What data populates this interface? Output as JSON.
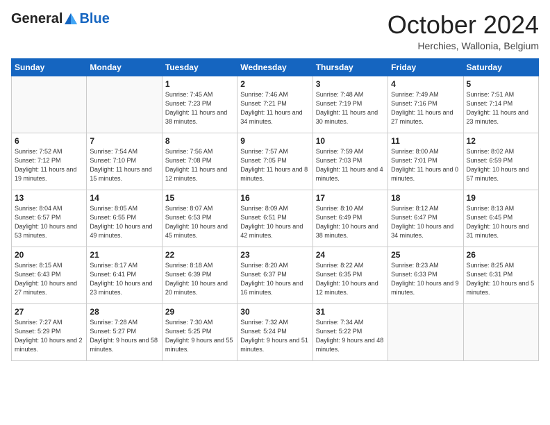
{
  "logo": {
    "general": "General",
    "blue": "Blue"
  },
  "header": {
    "month": "October 2024",
    "location": "Herchies, Wallonia, Belgium"
  },
  "days_of_week": [
    "Sunday",
    "Monday",
    "Tuesday",
    "Wednesday",
    "Thursday",
    "Friday",
    "Saturday"
  ],
  "weeks": [
    [
      {
        "day": "",
        "sunrise": "",
        "sunset": "",
        "daylight": ""
      },
      {
        "day": "",
        "sunrise": "",
        "sunset": "",
        "daylight": ""
      },
      {
        "day": "1",
        "sunrise": "Sunrise: 7:45 AM",
        "sunset": "Sunset: 7:23 PM",
        "daylight": "Daylight: 11 hours and 38 minutes."
      },
      {
        "day": "2",
        "sunrise": "Sunrise: 7:46 AM",
        "sunset": "Sunset: 7:21 PM",
        "daylight": "Daylight: 11 hours and 34 minutes."
      },
      {
        "day": "3",
        "sunrise": "Sunrise: 7:48 AM",
        "sunset": "Sunset: 7:19 PM",
        "daylight": "Daylight: 11 hours and 30 minutes."
      },
      {
        "day": "4",
        "sunrise": "Sunrise: 7:49 AM",
        "sunset": "Sunset: 7:16 PM",
        "daylight": "Daylight: 11 hours and 27 minutes."
      },
      {
        "day": "5",
        "sunrise": "Sunrise: 7:51 AM",
        "sunset": "Sunset: 7:14 PM",
        "daylight": "Daylight: 11 hours and 23 minutes."
      }
    ],
    [
      {
        "day": "6",
        "sunrise": "Sunrise: 7:52 AM",
        "sunset": "Sunset: 7:12 PM",
        "daylight": "Daylight: 11 hours and 19 minutes."
      },
      {
        "day": "7",
        "sunrise": "Sunrise: 7:54 AM",
        "sunset": "Sunset: 7:10 PM",
        "daylight": "Daylight: 11 hours and 15 minutes."
      },
      {
        "day": "8",
        "sunrise": "Sunrise: 7:56 AM",
        "sunset": "Sunset: 7:08 PM",
        "daylight": "Daylight: 11 hours and 12 minutes."
      },
      {
        "day": "9",
        "sunrise": "Sunrise: 7:57 AM",
        "sunset": "Sunset: 7:05 PM",
        "daylight": "Daylight: 11 hours and 8 minutes."
      },
      {
        "day": "10",
        "sunrise": "Sunrise: 7:59 AM",
        "sunset": "Sunset: 7:03 PM",
        "daylight": "Daylight: 11 hours and 4 minutes."
      },
      {
        "day": "11",
        "sunrise": "Sunrise: 8:00 AM",
        "sunset": "Sunset: 7:01 PM",
        "daylight": "Daylight: 11 hours and 0 minutes."
      },
      {
        "day": "12",
        "sunrise": "Sunrise: 8:02 AM",
        "sunset": "Sunset: 6:59 PM",
        "daylight": "Daylight: 10 hours and 57 minutes."
      }
    ],
    [
      {
        "day": "13",
        "sunrise": "Sunrise: 8:04 AM",
        "sunset": "Sunset: 6:57 PM",
        "daylight": "Daylight: 10 hours and 53 minutes."
      },
      {
        "day": "14",
        "sunrise": "Sunrise: 8:05 AM",
        "sunset": "Sunset: 6:55 PM",
        "daylight": "Daylight: 10 hours and 49 minutes."
      },
      {
        "day": "15",
        "sunrise": "Sunrise: 8:07 AM",
        "sunset": "Sunset: 6:53 PM",
        "daylight": "Daylight: 10 hours and 45 minutes."
      },
      {
        "day": "16",
        "sunrise": "Sunrise: 8:09 AM",
        "sunset": "Sunset: 6:51 PM",
        "daylight": "Daylight: 10 hours and 42 minutes."
      },
      {
        "day": "17",
        "sunrise": "Sunrise: 8:10 AM",
        "sunset": "Sunset: 6:49 PM",
        "daylight": "Daylight: 10 hours and 38 minutes."
      },
      {
        "day": "18",
        "sunrise": "Sunrise: 8:12 AM",
        "sunset": "Sunset: 6:47 PM",
        "daylight": "Daylight: 10 hours and 34 minutes."
      },
      {
        "day": "19",
        "sunrise": "Sunrise: 8:13 AM",
        "sunset": "Sunset: 6:45 PM",
        "daylight": "Daylight: 10 hours and 31 minutes."
      }
    ],
    [
      {
        "day": "20",
        "sunrise": "Sunrise: 8:15 AM",
        "sunset": "Sunset: 6:43 PM",
        "daylight": "Daylight: 10 hours and 27 minutes."
      },
      {
        "day": "21",
        "sunrise": "Sunrise: 8:17 AM",
        "sunset": "Sunset: 6:41 PM",
        "daylight": "Daylight: 10 hours and 23 minutes."
      },
      {
        "day": "22",
        "sunrise": "Sunrise: 8:18 AM",
        "sunset": "Sunset: 6:39 PM",
        "daylight": "Daylight: 10 hours and 20 minutes."
      },
      {
        "day": "23",
        "sunrise": "Sunrise: 8:20 AM",
        "sunset": "Sunset: 6:37 PM",
        "daylight": "Daylight: 10 hours and 16 minutes."
      },
      {
        "day": "24",
        "sunrise": "Sunrise: 8:22 AM",
        "sunset": "Sunset: 6:35 PM",
        "daylight": "Daylight: 10 hours and 12 minutes."
      },
      {
        "day": "25",
        "sunrise": "Sunrise: 8:23 AM",
        "sunset": "Sunset: 6:33 PM",
        "daylight": "Daylight: 10 hours and 9 minutes."
      },
      {
        "day": "26",
        "sunrise": "Sunrise: 8:25 AM",
        "sunset": "Sunset: 6:31 PM",
        "daylight": "Daylight: 10 hours and 5 minutes."
      }
    ],
    [
      {
        "day": "27",
        "sunrise": "Sunrise: 7:27 AM",
        "sunset": "Sunset: 5:29 PM",
        "daylight": "Daylight: 10 hours and 2 minutes."
      },
      {
        "day": "28",
        "sunrise": "Sunrise: 7:28 AM",
        "sunset": "Sunset: 5:27 PM",
        "daylight": "Daylight: 9 hours and 58 minutes."
      },
      {
        "day": "29",
        "sunrise": "Sunrise: 7:30 AM",
        "sunset": "Sunset: 5:25 PM",
        "daylight": "Daylight: 9 hours and 55 minutes."
      },
      {
        "day": "30",
        "sunrise": "Sunrise: 7:32 AM",
        "sunset": "Sunset: 5:24 PM",
        "daylight": "Daylight: 9 hours and 51 minutes."
      },
      {
        "day": "31",
        "sunrise": "Sunrise: 7:34 AM",
        "sunset": "Sunset: 5:22 PM",
        "daylight": "Daylight: 9 hours and 48 minutes."
      },
      {
        "day": "",
        "sunrise": "",
        "sunset": "",
        "daylight": ""
      },
      {
        "day": "",
        "sunrise": "",
        "sunset": "",
        "daylight": ""
      }
    ]
  ]
}
